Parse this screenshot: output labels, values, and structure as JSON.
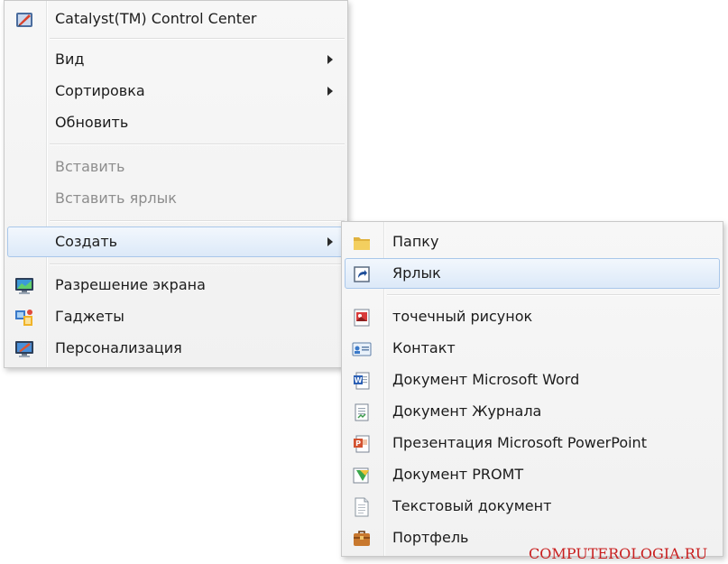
{
  "context_menu": {
    "items": [
      {
        "label": "Catalyst(TM) Control Center",
        "icon": "catalyst-icon"
      },
      {
        "label": "Вид",
        "submenu": true
      },
      {
        "label": "Сортировка",
        "submenu": true
      },
      {
        "label": "Обновить"
      },
      {
        "label": "Вставить",
        "disabled": true
      },
      {
        "label": "Вставить ярлык",
        "disabled": true
      },
      {
        "label": "Создать",
        "submenu": true,
        "highlighted": true
      },
      {
        "label": "Разрешение экрана",
        "icon": "display-icon"
      },
      {
        "label": "Гаджеты",
        "icon": "gadgets-icon"
      },
      {
        "label": "Персонализация",
        "icon": "personalize-icon"
      }
    ]
  },
  "submenu": {
    "items": [
      {
        "label": "Папку",
        "icon": "folder-icon"
      },
      {
        "label": "Ярлык",
        "icon": "shortcut-icon",
        "highlighted": true
      },
      {
        "label": "точечный рисунок",
        "icon": "bitmap-icon"
      },
      {
        "label": "Контакт",
        "icon": "contact-icon"
      },
      {
        "label": "Документ Microsoft Word",
        "icon": "word-icon"
      },
      {
        "label": "Документ Журнала",
        "icon": "journal-icon"
      },
      {
        "label": "Презентация Microsoft PowerPoint",
        "icon": "powerpoint-icon"
      },
      {
        "label": "Документ PROMT",
        "icon": "promt-icon"
      },
      {
        "label": "Текстовый документ",
        "icon": "text-document-icon"
      },
      {
        "label": "Портфель",
        "icon": "briefcase-icon"
      }
    ]
  },
  "watermark": "COMPUTEROLOGIA.RU",
  "colors": {
    "highlight_bg": "#dce9f8",
    "highlight_border": "#a9c7ea",
    "disabled_text": "#8d8d8d",
    "watermark": "#c81e1e"
  }
}
